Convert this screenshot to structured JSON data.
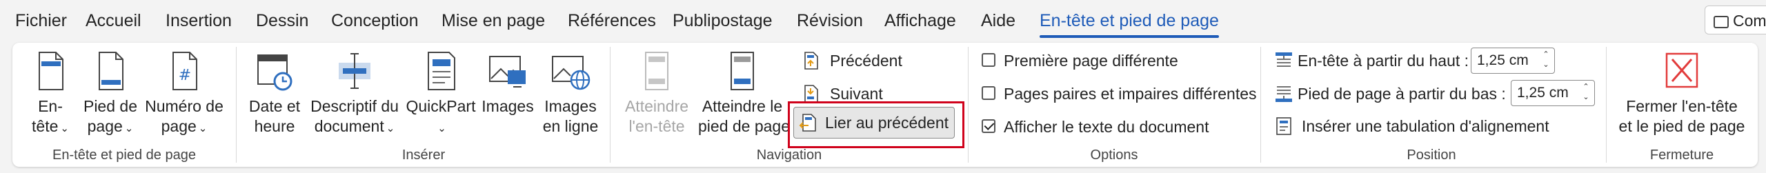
{
  "menubar": {
    "tabs": [
      {
        "label": "Fichier"
      },
      {
        "label": "Accueil"
      },
      {
        "label": "Insertion"
      },
      {
        "label": "Dessin"
      },
      {
        "label": "Conception"
      },
      {
        "label": "Mise en page"
      },
      {
        "label": "Références"
      },
      {
        "label": "Publipostage"
      },
      {
        "label": "Révision"
      },
      {
        "label": "Affichage"
      },
      {
        "label": "Aide"
      },
      {
        "label": "En-tête et pied de page"
      }
    ],
    "active_tab": "En-tête et pied de page",
    "comment_button": "Comm"
  },
  "groups": {
    "header_footer": {
      "label": "En-tête et pied de page",
      "buttons": [
        {
          "line1": "En-",
          "line2": "tête",
          "icon": "header-icon"
        },
        {
          "line1": "Pied de",
          "line2": "page",
          "icon": "footer-icon"
        },
        {
          "line1": "Numéro de",
          "line2": "page",
          "icon": "page-number-icon"
        }
      ]
    },
    "insert": {
      "label": "Insérer",
      "buttons": [
        {
          "line1": "Date et",
          "line2": "heure",
          "icon": "date-time-icon"
        },
        {
          "line1": "Descriptif du",
          "line2": "document",
          "icon": "document-info-icon"
        },
        {
          "line1": "QuickPart",
          "line2": "",
          "icon": "quickpart-icon"
        },
        {
          "line1": "Images",
          "line2": "",
          "icon": "images-icon"
        },
        {
          "line1": "Images",
          "line2": "en ligne",
          "icon": "online-images-icon"
        }
      ]
    },
    "navigation": {
      "label": "Navigation",
      "goto_header": {
        "line1": "Atteindre",
        "line2": "l'en-tête",
        "disabled": true
      },
      "goto_footer": {
        "line1": "Atteindre le",
        "line2": "pied de page"
      },
      "previous": "Précédent",
      "next": "Suivant",
      "link_previous": "Lier au précédent"
    },
    "options": {
      "label": "Options",
      "checkboxes": [
        {
          "label": "Première page différente",
          "checked": false
        },
        {
          "label": "Pages paires et impaires différentes",
          "checked": false
        },
        {
          "label": "Afficher le texte du document",
          "checked": true
        }
      ]
    },
    "position": {
      "label": "Position",
      "header_from_top": {
        "label": "En-tête à partir du haut :",
        "value": "1,25 cm"
      },
      "footer_from_bottom": {
        "label": "Pied de page à partir du bas :",
        "value": "1,25 cm"
      },
      "insert_alignment_tab": "Insérer une tabulation d'alignement"
    },
    "close": {
      "label": "Fermeture",
      "button": {
        "line1": "Fermer l'en-tête",
        "line2": "et le pied de page"
      }
    }
  },
  "colors": {
    "accent": "#1e5bb8",
    "icon_blue": "#2f6fbf",
    "close_red": "#e23b3b",
    "highlight": "#d0021b"
  }
}
